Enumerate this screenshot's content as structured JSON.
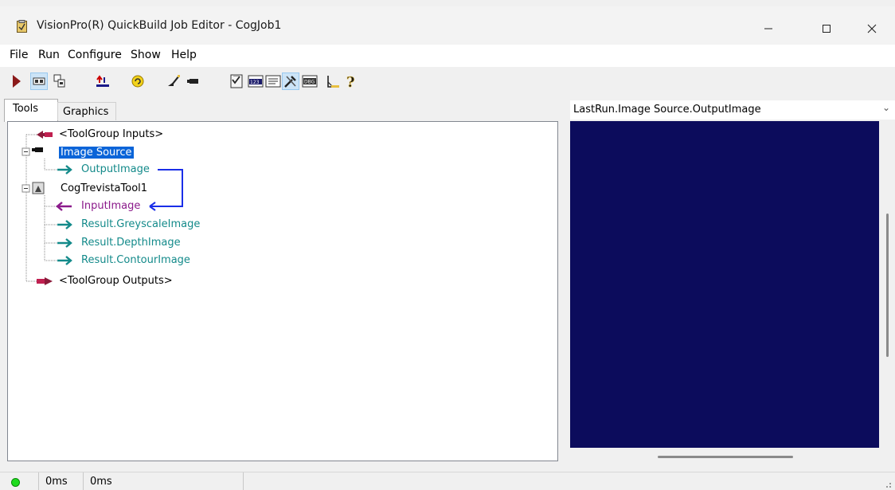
{
  "window": {
    "title": "VisionPro(R) QuickBuild Job Editor - CogJob1",
    "controls": [
      "minimize-icon",
      "maximize-icon",
      "close-icon"
    ]
  },
  "menu": [
    "File",
    "Run",
    "Configure",
    "Show",
    "Help"
  ],
  "toolbar_icons": [
    "run-icon",
    "image-display-icon",
    "tool-display-icon",
    "load-icon",
    "refresh-icon",
    "edit-icon",
    "camera-icon",
    "results-icon",
    "numbers-icon",
    "text-icon",
    "tools-icon",
    "debug-icon",
    "measure-icon",
    "help-icon"
  ],
  "tabs": {
    "tools": "Tools",
    "graphics": "Graphics"
  },
  "tree": {
    "toolgroup_inputs": "<ToolGroup Inputs>",
    "image_source": "Image Source",
    "output_image": "OutputImage",
    "trevista_tool": "CogTrevistaTool1",
    "input_image": "InputImage",
    "result_greyscale": "Result.GreyscaleImage",
    "result_depth": "Result.DepthImage",
    "result_contour": "Result.ContourImage",
    "toolgroup_outputs": "<ToolGroup Outputs>"
  },
  "display": {
    "selector_value": "LastRun.Image Source.OutputImage",
    "background_color": "#0c0c5c"
  },
  "status": {
    "time1": "0ms",
    "time2": "0ms",
    "indicator_color": "#1fdc1f"
  }
}
